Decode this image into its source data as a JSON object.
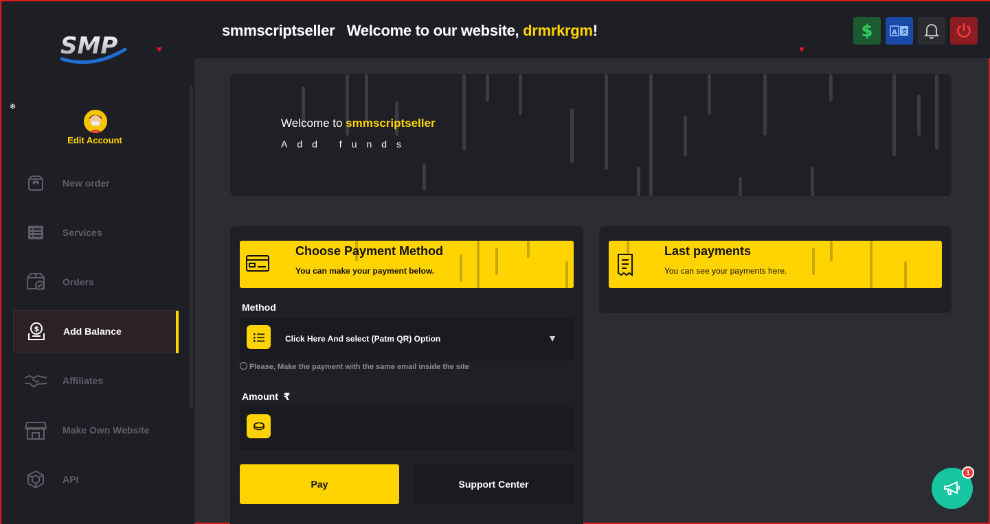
{
  "header": {
    "site_name": "smmscriptseller",
    "welcome_prefix": "Welcome to our website, ",
    "username": "drmrkrgm",
    "welcome_suffix": "!",
    "buttons": [
      {
        "name": "currency-button",
        "icon": "dollar-icon",
        "color": "#1d5a32"
      },
      {
        "name": "language-button",
        "icon": "translate-icon",
        "color": "#1a4aa8"
      },
      {
        "name": "notifications-button",
        "icon": "bell-icon",
        "color": "#2b2d33"
      },
      {
        "name": "logout-button",
        "icon": "power-icon",
        "color": "#8b1d22"
      }
    ]
  },
  "sidebar": {
    "logo_text": "SMP",
    "edit_account": "Edit Account",
    "items": [
      {
        "label": "New order",
        "icon": "new-order-icon"
      },
      {
        "label": "Services",
        "icon": "services-list-icon"
      },
      {
        "label": "Orders",
        "icon": "orders-box-icon"
      },
      {
        "label": "Add Balance",
        "icon": "add-balance-icon",
        "active": true
      },
      {
        "label": "Affiliates",
        "icon": "handshake-icon"
      },
      {
        "label": "Make Own Website",
        "icon": "store-icon"
      },
      {
        "label": "API",
        "icon": "api-icon"
      }
    ]
  },
  "hero": {
    "welcome_prefix": "Welcome to ",
    "brand": "smmscriptseller",
    "subtitle": "Add funds"
  },
  "payment_card": {
    "title": "Choose Payment Method",
    "subtitle": "You can make your payment below.",
    "method_label": "Method",
    "method_value": "Click Here And select (Patm QR) Option",
    "note": "Please, Make the payment with the same email inside the site",
    "amount_label": "Amount",
    "currency_symbol": "₹",
    "amount_value": "",
    "pay_label": "Pay",
    "support_label": "Support Center"
  },
  "last_payments": {
    "title": "Last payments",
    "subtitle": "You can see your payments here."
  },
  "fab": {
    "badge": "1"
  },
  "colors": {
    "accent": "#ffd400",
    "sidebar_bg": "#1e1f25",
    "page_bg": "#2b2d33",
    "fab": "#17c5a0"
  }
}
